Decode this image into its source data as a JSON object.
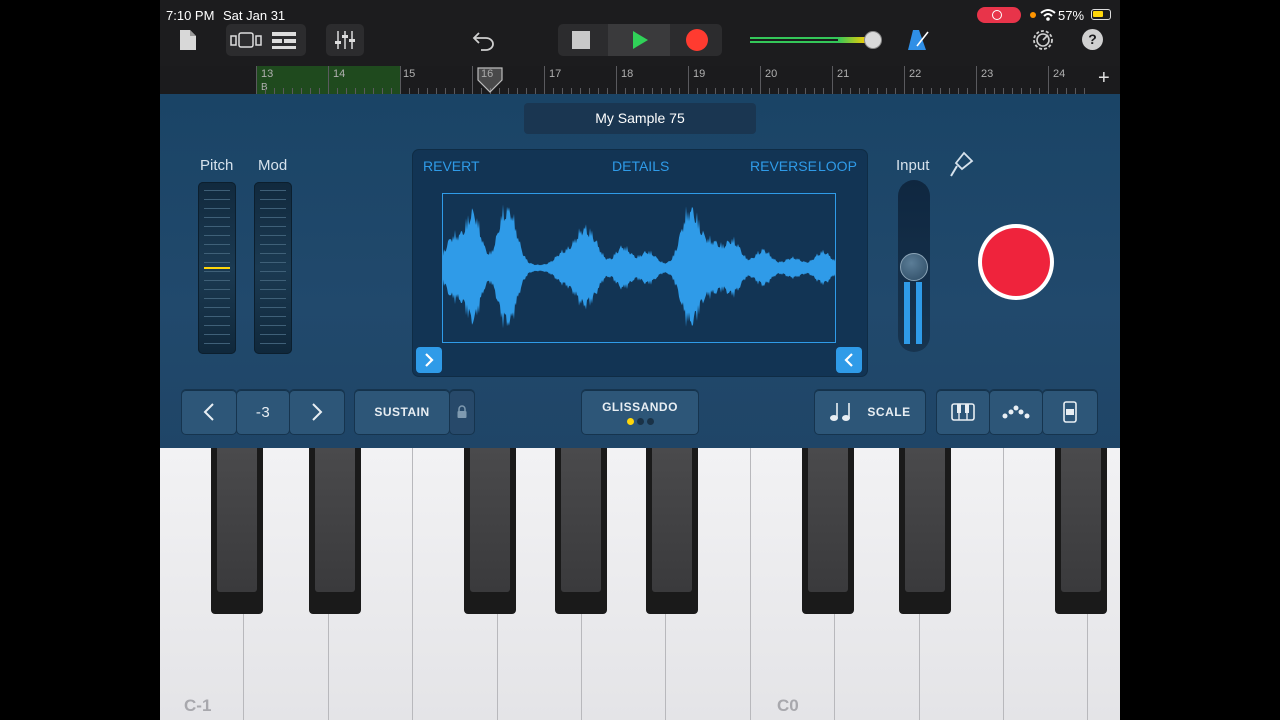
{
  "status": {
    "time": "7:10 PM",
    "date": "Sat Jan 31",
    "battery": "57%"
  },
  "toolbar": {
    "icons": [
      "document-icon",
      "track-view-icon",
      "tracks-list-icon",
      "mixer-icon",
      "undo-icon",
      "stop-icon",
      "play-icon",
      "record-icon",
      "master-volume-slider",
      "metronome-icon",
      "settings-icon",
      "help-icon"
    ],
    "help_label": "?",
    "colors": {
      "play": "#30d158",
      "record": "#ff3b30",
      "volume": "#34c759"
    }
  },
  "ruler": {
    "bars": [
      "13",
      "14",
      "15",
      "16",
      "17",
      "18",
      "19",
      "20",
      "21",
      "22",
      "23",
      "24"
    ],
    "section_label": "B",
    "add_label": "+"
  },
  "sampler": {
    "sample_name": "My Sample 75",
    "pitch_label": "Pitch",
    "mod_label": "Mod",
    "revert_label": "REVERT",
    "details_label": "DETAILS",
    "reverse_label": "REVERSE",
    "loop_label": "LOOP",
    "input_label": "Input",
    "accent_color": "#2f9be8",
    "record_color": "#ef233c"
  },
  "controls": {
    "octave_value": "-3",
    "sustain_label": "SUSTAIN",
    "glissando_label": "GLISSANDO",
    "scale_label": "SCALE"
  },
  "keyboard": {
    "labels": [
      "C-1",
      "C0"
    ]
  }
}
